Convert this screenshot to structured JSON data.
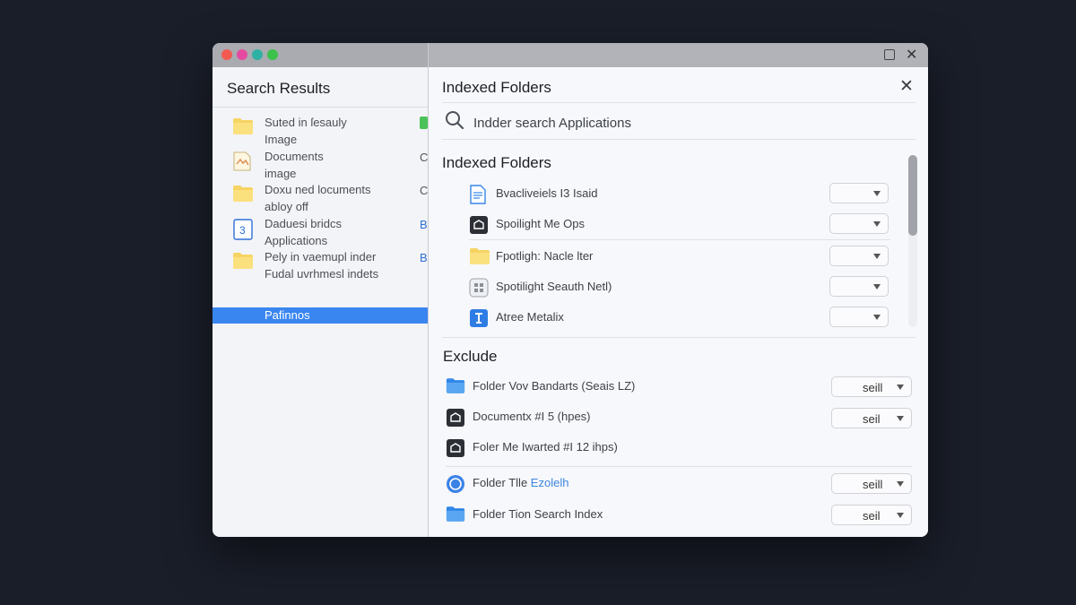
{
  "left_window": {
    "title": "Search Results",
    "results": [
      {
        "line1": "Suted in ſesauly",
        "line2": "Image",
        "icon": "folder-icon",
        "edge": ""
      },
      {
        "line1": "Documents",
        "line2": "image",
        "icon": "document-image-icon",
        "edge": "C"
      },
      {
        "line1": "Doxu ned locuments",
        "line2": "abloy off",
        "icon": "folder-icon",
        "edge": "C"
      },
      {
        "line1": "Daduesi bridcs",
        "line2": "Applications",
        "icon": "app-icon",
        "edge": "B"
      },
      {
        "line1": "Pely in vaemupl inder",
        "line2": "Fudal uvrhmesl indets",
        "icon": "folder-icon",
        "edge": "B"
      }
    ],
    "selected_label": "Pafinnos"
  },
  "panel": {
    "title": "Indexed Folders",
    "search_text": "Indder search Applications",
    "indexed_section_title": "Indexed Folders",
    "indexed_items": [
      {
        "label": "Bvacliveiels I3 Isaid",
        "icon": "document-icon"
      },
      {
        "label": "Spoilight Me Ops",
        "icon": "app-dark-icon"
      },
      {
        "label": "Fpotligh: Nacle lter",
        "icon": "folder-icon"
      },
      {
        "label": "Spotilight Seauth Netl)",
        "icon": "grid-app-icon"
      },
      {
        "label": "Atree Metalix",
        "icon": "blue-app-icon"
      }
    ],
    "exclude_section_title": "Exclude",
    "exclude_items": [
      {
        "label": "Folder Vov Bandarts (Seais LZ)",
        "link": "",
        "icon": "blue-folder-icon",
        "dropdown": "seill"
      },
      {
        "label": "Documentx #I 5 (hpes)",
        "link": "",
        "icon": "app-dark-icon",
        "dropdown": "seil"
      },
      {
        "label": "Foler Me Iwarted #I 12 ihps)",
        "link": "",
        "icon": "app-dark-icon",
        "dropdown": ""
      },
      {
        "label": "Folder Tlle ",
        "link": "Ezolelh",
        "icon": "circle-app-icon",
        "dropdown": "seill"
      },
      {
        "label": "Folder Tion Search Index",
        "link": "",
        "icon": "blue-folder-icon",
        "dropdown": "seil"
      }
    ]
  }
}
